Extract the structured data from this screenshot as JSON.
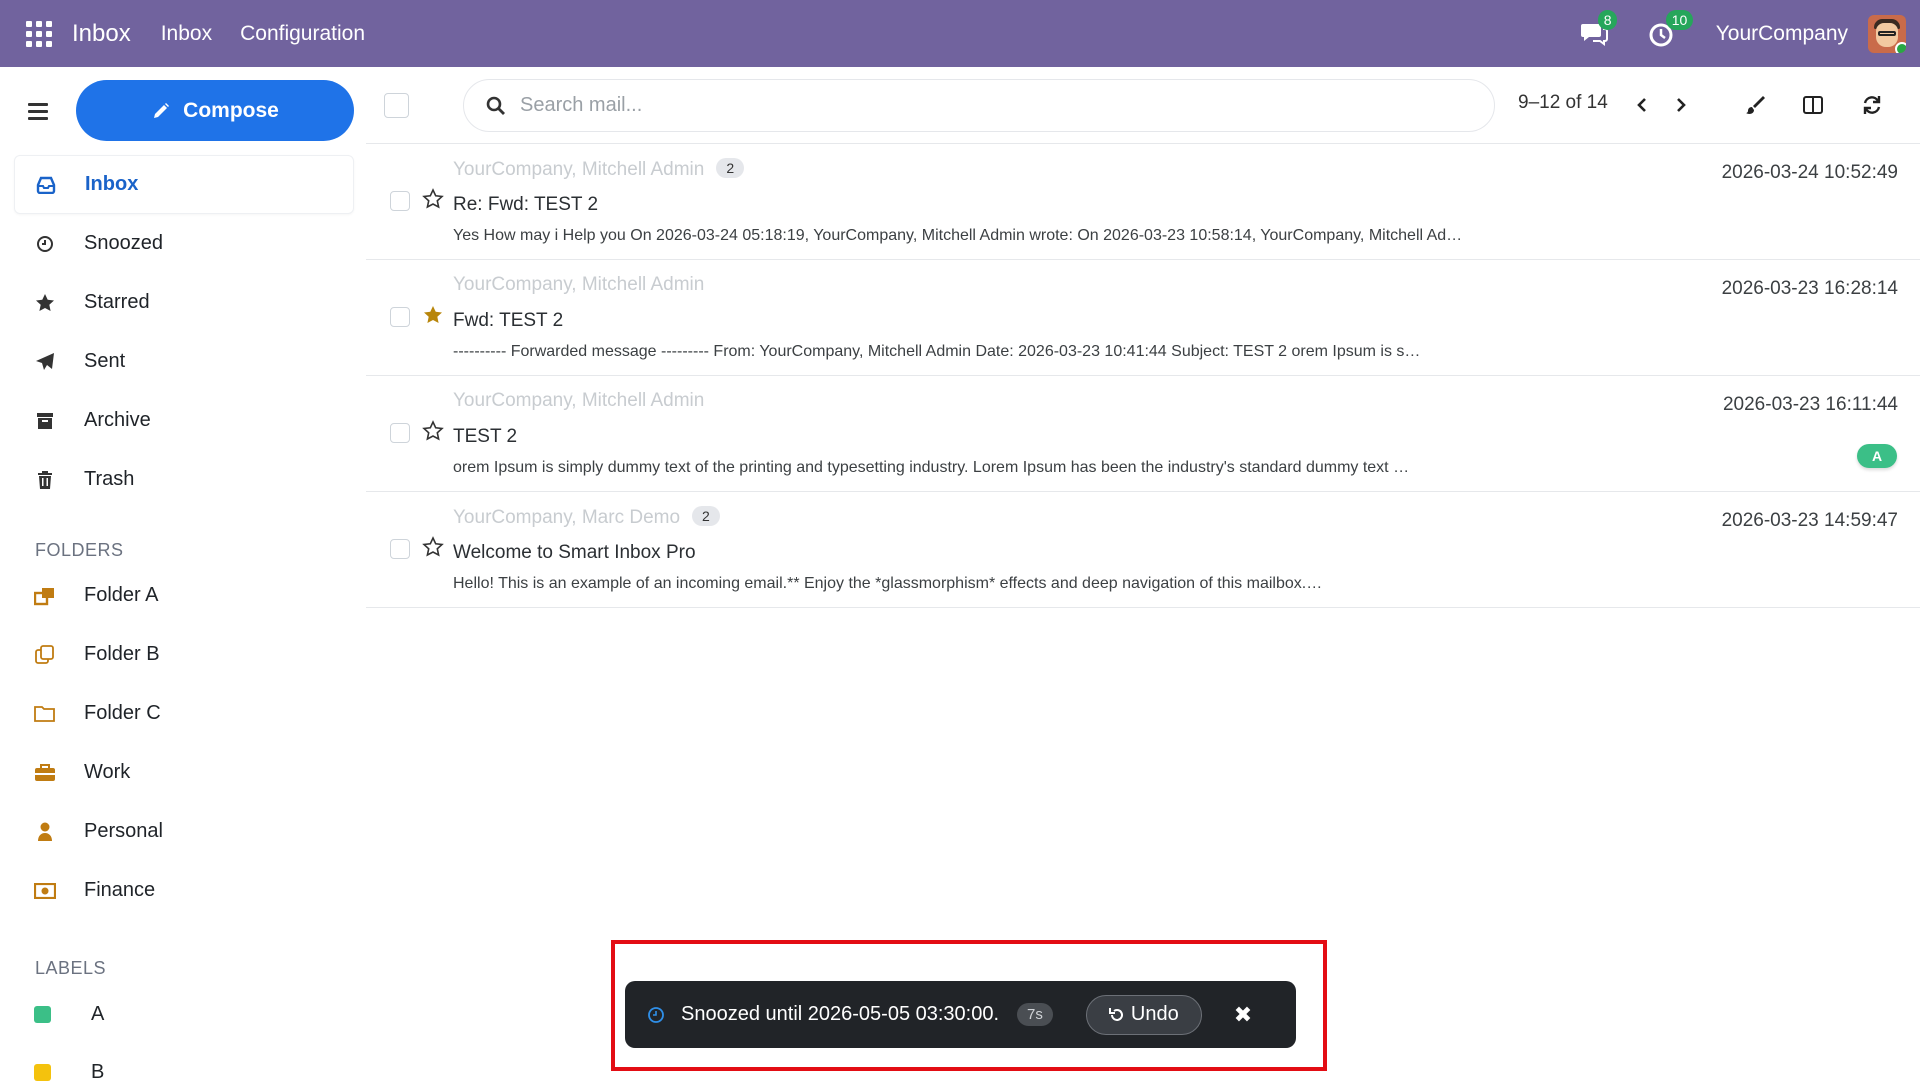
{
  "topbar": {
    "brand": "Inbox",
    "nav": [
      "Inbox",
      "Configuration"
    ],
    "chat_count": "8",
    "activity_count": "10",
    "company": "YourCompany"
  },
  "sidebar": {
    "compose_label": "Compose",
    "items": [
      {
        "label": "Inbox",
        "icon": "inbox-icon"
      },
      {
        "label": "Snoozed",
        "icon": "clock-icon"
      },
      {
        "label": "Starred",
        "icon": "star-icon"
      },
      {
        "label": "Sent",
        "icon": "send-icon"
      },
      {
        "label": "Archive",
        "icon": "archive-icon"
      },
      {
        "label": "Trash",
        "icon": "trash-icon"
      }
    ],
    "folders_title": "FOLDERS",
    "folders": [
      {
        "label": "Folder A",
        "icon": "folder-multi-icon",
        "color": "#c07c12"
      },
      {
        "label": "Folder B",
        "icon": "folder-copy-icon",
        "color": "#c07c12"
      },
      {
        "label": "Folder C",
        "icon": "folder-icon",
        "color": "#c07c12"
      },
      {
        "label": "Work",
        "icon": "briefcase-icon",
        "color": "#c07c12"
      },
      {
        "label": "Personal",
        "icon": "user-icon",
        "color": "#c07c12"
      },
      {
        "label": "Finance",
        "icon": "money-icon",
        "color": "#c07c12"
      }
    ],
    "labels_title": "LABELS",
    "labels": [
      {
        "label": "A",
        "color": "#3bbf87"
      },
      {
        "label": "B",
        "color": "#f4c20d"
      }
    ]
  },
  "toolbar": {
    "search_placeholder": "Search mail...",
    "pager": "9–12 of 14"
  },
  "mails": [
    {
      "sender": "YourCompany, Mitchell Admin",
      "count": "2",
      "subject": "Re: Fwd: TEST 2",
      "snippet": "Yes How may i Help you On 2026-03-24 05:18:19, YourCompany, Mitchell Admin wrote: On 2026-03-23 10:58:14, YourCompany, Mitchell Ad…",
      "date": "2026-03-24 10:52:49",
      "starred": false
    },
    {
      "sender": "YourCompany, Mitchell Admin",
      "count": "",
      "subject": "Fwd: TEST 2",
      "snippet": "---------- Forwarded message --------- From: YourCompany, Mitchell Admin Date: 2026-03-23 10:41:44 Subject: TEST 2 orem Ipsum is s…",
      "date": "2026-03-23 16:28:14",
      "starred": true
    },
    {
      "sender": "YourCompany, Mitchell Admin",
      "count": "",
      "subject": "TEST 2",
      "snippet": "orem Ipsum is simply dummy text of the printing and typesetting industry. Lorem Ipsum has been the industry's standard dummy text …",
      "date": "2026-03-23 16:11:44",
      "starred": false,
      "label": "A"
    },
    {
      "sender": "YourCompany, Marc Demo",
      "count": "2",
      "subject": "Welcome to Smart Inbox Pro",
      "snippet": "Hello! This is an example of an incoming email.** Enjoy the *glassmorphism* effects and deep navigation of this mailbox.…",
      "date": "2026-03-23 14:59:47",
      "starred": false
    }
  ],
  "toast": {
    "message": "Snoozed until 2026-05-05 03:30:00.",
    "timer": "7s",
    "undo_label": "Undo"
  },
  "colors": {
    "topbar": "#71639e",
    "compose": "#1f73e8",
    "active": "#1a63c9",
    "star_filled": "#b8860b",
    "highlight": "#e30d14"
  }
}
